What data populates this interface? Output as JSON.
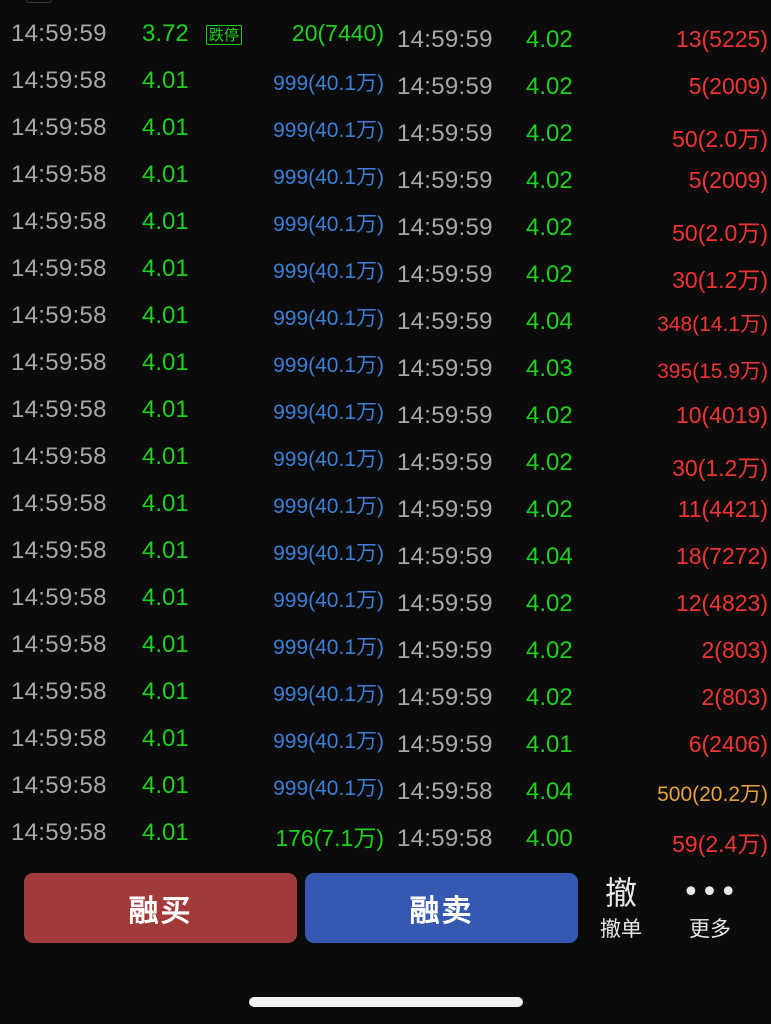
{
  "left_rows": [
    {
      "time": "14:59:59",
      "price": "3.72",
      "tag": "跌停",
      "vol": "20(7440)",
      "color": "green"
    },
    {
      "time": "14:59:58",
      "price": "4.01",
      "vol": "999(40.1万)",
      "color": "blue"
    },
    {
      "time": "14:59:58",
      "price": "4.01",
      "vol": "999(40.1万)",
      "color": "blue"
    },
    {
      "time": "14:59:58",
      "price": "4.01",
      "vol": "999(40.1万)",
      "color": "blue"
    },
    {
      "time": "14:59:58",
      "price": "4.01",
      "vol": "999(40.1万)",
      "color": "blue"
    },
    {
      "time": "14:59:58",
      "price": "4.01",
      "vol": "999(40.1万)",
      "color": "blue"
    },
    {
      "time": "14:59:58",
      "price": "4.01",
      "vol": "999(40.1万)",
      "color": "blue"
    },
    {
      "time": "14:59:58",
      "price": "4.01",
      "vol": "999(40.1万)",
      "color": "blue"
    },
    {
      "time": "14:59:58",
      "price": "4.01",
      "vol": "999(40.1万)",
      "color": "blue"
    },
    {
      "time": "14:59:58",
      "price": "4.01",
      "vol": "999(40.1万)",
      "color": "blue"
    },
    {
      "time": "14:59:58",
      "price": "4.01",
      "vol": "999(40.1万)",
      "color": "blue"
    },
    {
      "time": "14:59:58",
      "price": "4.01",
      "vol": "999(40.1万)",
      "color": "blue"
    },
    {
      "time": "14:59:58",
      "price": "4.01",
      "vol": "999(40.1万)",
      "color": "blue"
    },
    {
      "time": "14:59:58",
      "price": "4.01",
      "vol": "999(40.1万)",
      "color": "blue"
    },
    {
      "time": "14:59:58",
      "price": "4.01",
      "vol": "999(40.1万)",
      "color": "blue"
    },
    {
      "time": "14:59:58",
      "price": "4.01",
      "vol": "999(40.1万)",
      "color": "blue"
    },
    {
      "time": "14:59:58",
      "price": "4.01",
      "vol": "999(40.1万)",
      "color": "blue"
    },
    {
      "time": "14:59:58",
      "price": "4.01",
      "vol": "176(7.1万)",
      "color": "green"
    }
  ],
  "right_rows": [
    {
      "time": "14:59:59",
      "price": "4.02",
      "vol": "13(5225)",
      "color": "red"
    },
    {
      "time": "14:59:59",
      "price": "4.02",
      "vol": "5(2009)",
      "color": "red"
    },
    {
      "time": "14:59:59",
      "price": "4.02",
      "vol": "50(2.0万)",
      "color": "red"
    },
    {
      "time": "14:59:59",
      "price": "4.02",
      "vol": "5(2009)",
      "color": "red"
    },
    {
      "time": "14:59:59",
      "price": "4.02",
      "vol": "50(2.0万)",
      "color": "red"
    },
    {
      "time": "14:59:59",
      "price": "4.02",
      "vol": "30(1.2万)",
      "color": "red"
    },
    {
      "time": "14:59:59",
      "price": "4.04",
      "vol": "348(14.1万)",
      "color": "red-sm"
    },
    {
      "time": "14:59:59",
      "price": "4.03",
      "vol": "395(15.9万)",
      "color": "red-sm"
    },
    {
      "time": "14:59:59",
      "price": "4.02",
      "vol": "10(4019)",
      "color": "red"
    },
    {
      "time": "14:59:59",
      "price": "4.02",
      "vol": "30(1.2万)",
      "color": "red"
    },
    {
      "time": "14:59:59",
      "price": "4.02",
      "vol": "11(4421)",
      "color": "red"
    },
    {
      "time": "14:59:59",
      "price": "4.04",
      "vol": "18(7272)",
      "color": "red"
    },
    {
      "time": "14:59:59",
      "price": "4.02",
      "vol": "12(4823)",
      "color": "red"
    },
    {
      "time": "14:59:59",
      "price": "4.02",
      "vol": "2(803)",
      "color": "red"
    },
    {
      "time": "14:59:59",
      "price": "4.02",
      "vol": "2(803)",
      "color": "red"
    },
    {
      "time": "14:59:59",
      "price": "4.01",
      "vol": "6(2406)",
      "color": "red"
    },
    {
      "time": "14:59:58",
      "price": "4.04",
      "vol": "500(20.2万)",
      "color": "orange"
    },
    {
      "time": "14:59:58",
      "price": "4.00",
      "vol": "59(2.4万)",
      "color": "red"
    }
  ],
  "actions": {
    "margin_buy": "融买",
    "margin_sell": "融卖",
    "cancel_glyph": "撤",
    "cancel_label": "撤单",
    "more_label": "更多"
  },
  "colors": {
    "up": "#f03434",
    "down": "#1fd11f",
    "neutral_big": "#3d7fd6",
    "large_order": "#e8a33d",
    "buy_button": "#a33a3a",
    "sell_button": "#3558b0"
  },
  "icons": {
    "more": "more-dots-icon"
  }
}
